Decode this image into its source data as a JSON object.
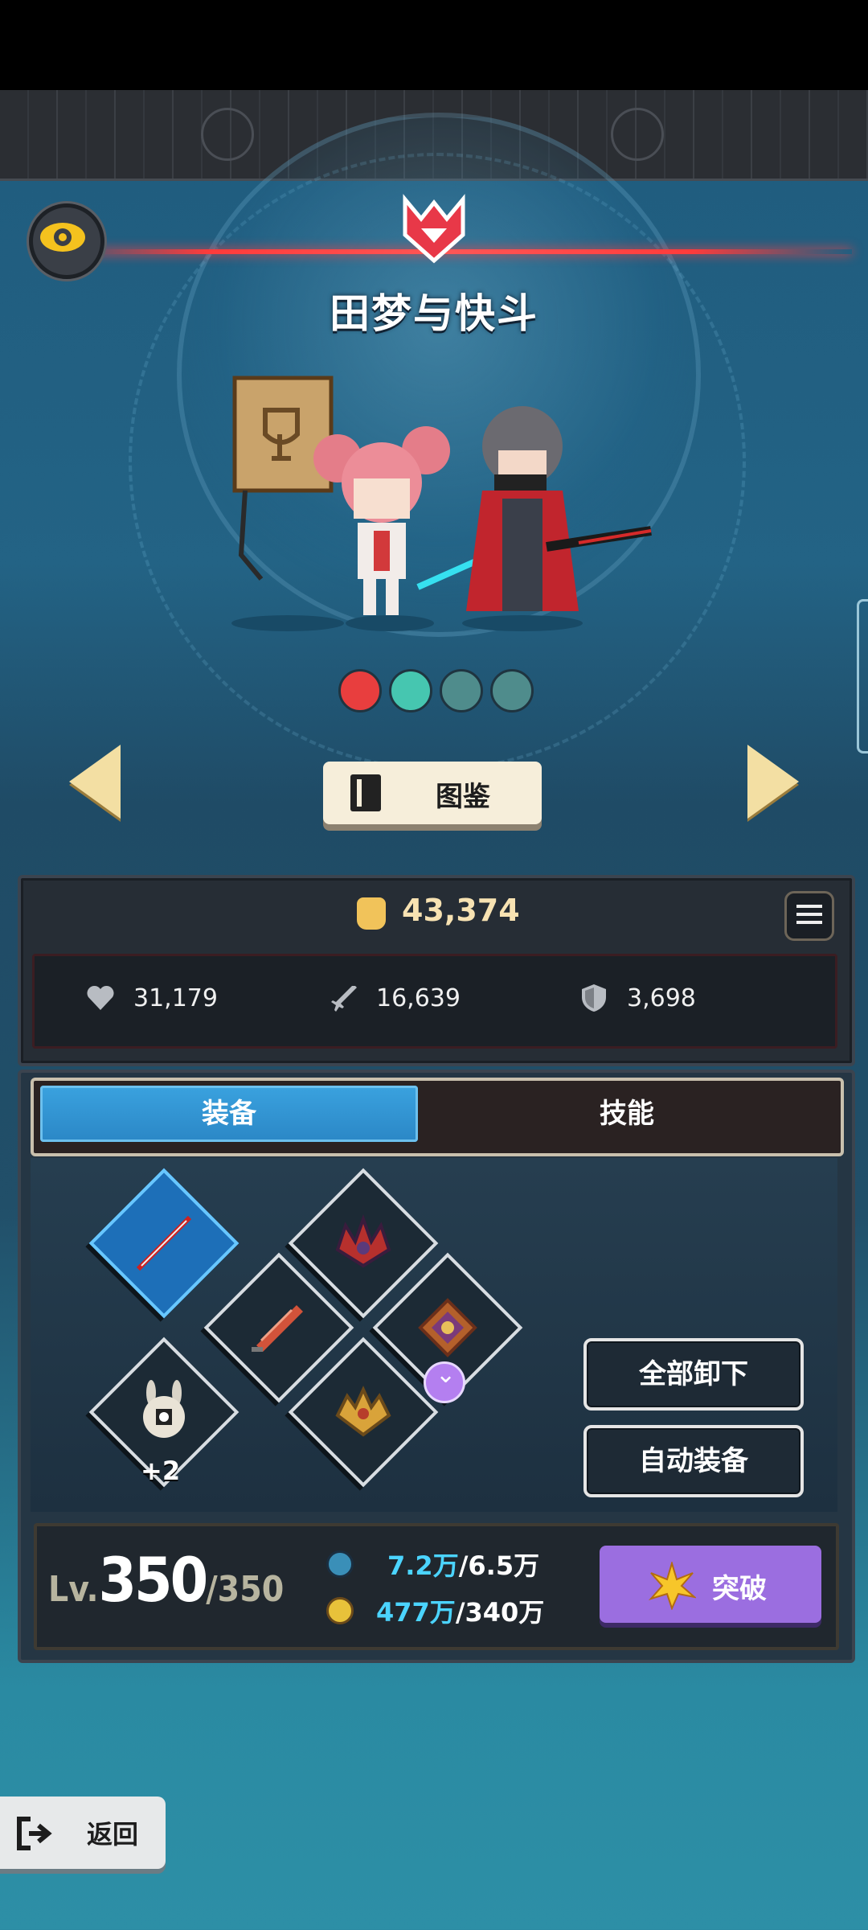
{
  "hero": {
    "name": "田梦与快斗"
  },
  "codex": {
    "label": "图鉴"
  },
  "stats": {
    "power": "43,374",
    "hp": "31,179",
    "attack": "16,639",
    "defense": "3,698"
  },
  "tabs": {
    "equipment": "装备",
    "skills": "技能",
    "active": "equipment"
  },
  "equipment": {
    "pet_bonus": "+2"
  },
  "actions": {
    "unequip_all": "全部卸下",
    "auto_equip": "自动装备"
  },
  "level": {
    "prefix": "Lv.",
    "current": "350",
    "max": "/350"
  },
  "resources": {
    "res1_have": "7.2万",
    "res1_need": "/6.5万",
    "res2_have": "477万",
    "res2_need": "/340万"
  },
  "breakthrough": {
    "label": "突破"
  },
  "back": {
    "label": "返回"
  },
  "colors": {
    "accent_blue": "#2b87c6",
    "break_purple": "#9b6ee0",
    "gold": "#f7e2b2",
    "highlight": "#4bd4ff"
  }
}
